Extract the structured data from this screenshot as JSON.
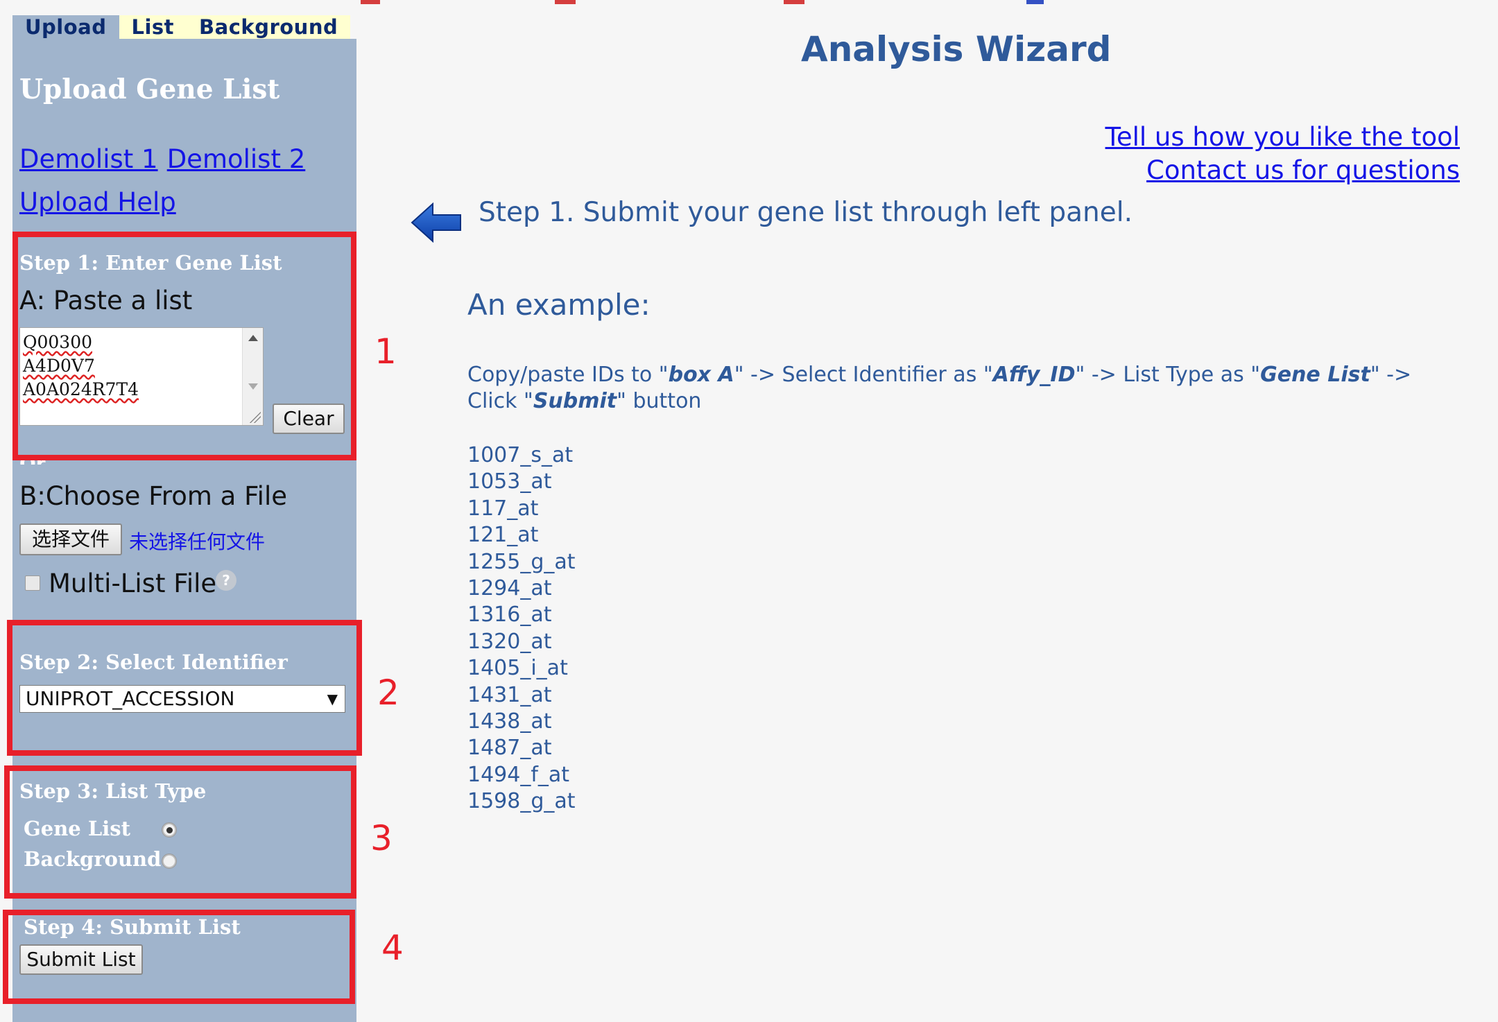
{
  "tabs": [
    {
      "label": "Upload",
      "active": true
    },
    {
      "label": "List",
      "active": false
    },
    {
      "label": "Background",
      "active": false
    }
  ],
  "sidebar": {
    "title": "Upload Gene List",
    "demolist1": "Demolist 1",
    "demolist2": "Demolist 2",
    "upload_help": "Upload Help",
    "step1": {
      "heading": "Step 1: Enter Gene List",
      "paste_label": "A: Paste a list",
      "textarea_lines": [
        "Q00300",
        "A4D0V7",
        "A0A024R7T4"
      ],
      "clear_button": "Clear",
      "or_label": "Or",
      "file_label": "B:Choose From a File",
      "choose_file_button": "选择文件",
      "no_file_text": "未选择任何文件",
      "multi_list_label": "Multi-List File",
      "help_icon": "?"
    },
    "step2": {
      "heading": "Step 2: Select Identifier",
      "selected_identifier": "UNIPROT_ACCESSION",
      "dropdown_arrow": "▼"
    },
    "step3": {
      "heading": "Step 3: List Type",
      "option_gene_list": "Gene List",
      "option_background": "Background",
      "selected": "Gene List"
    },
    "step4": {
      "heading": "Step 4: Submit List",
      "submit_button": "Submit List"
    }
  },
  "annotations": [
    "1",
    "2",
    "3",
    "4"
  ],
  "main": {
    "title": "Analysis Wizard",
    "feedback_link": "Tell us how you like the tool",
    "contact_link": "Contact us for questions",
    "step1_instruction": "Step 1. Submit your gene list through left panel.",
    "example_heading": "An example:",
    "instruction_parts": {
      "p1": "Copy/paste IDs to \"",
      "box": "box A",
      "p2": "\" -> Select Identifier as  \"",
      "affy": "Affy_ID",
      "p3": "\" -> List Type as \"",
      "gene_list": "Gene List",
      "p4": "\" -> Click \"",
      "submit": "Submit",
      "p5": "\" button"
    },
    "example_ids": [
      "1007_s_at",
      "1053_at",
      "117_at",
      "121_at",
      "1255_g_at",
      "1294_at",
      "1316_at",
      "1320_at",
      "1405_i_at",
      "1431_at",
      "1438_at",
      "1487_at",
      "1494_f_at",
      "1598_g_at"
    ]
  },
  "colors": {
    "panel": "#a0b4cc",
    "annotation_red": "#e8202a",
    "link_blue": "#1414e6",
    "heading_blue": "#2f5a9a"
  }
}
